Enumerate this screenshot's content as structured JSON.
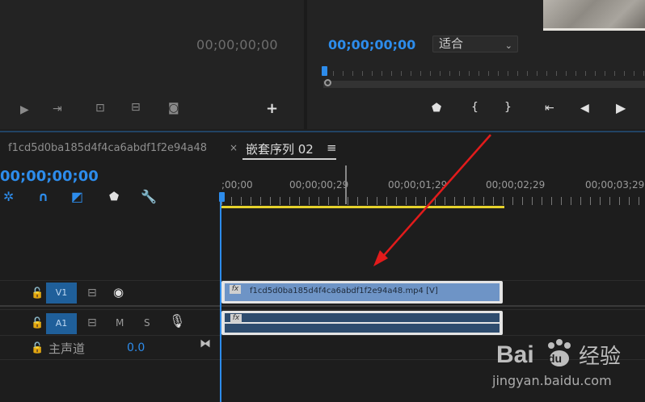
{
  "source_monitor": {
    "timecode": "00;00;00;00"
  },
  "program_monitor": {
    "timecode": "00;00;00;00",
    "fit_select": {
      "value": "适合"
    }
  },
  "timeline": {
    "tabs": [
      {
        "label": "f1cd5d0ba185d4f4ca6abdf1f2e94a48"
      },
      {
        "label": "嵌套序列 02",
        "close": "×",
        "menu": "≡"
      }
    ],
    "timecode": "00;00;00;00",
    "ruler_labels": [
      ";00;00",
      "00;00;00;29",
      "00;00;01;29",
      "00;00;02;29",
      "00;00;03;29"
    ],
    "tracks": {
      "v1": {
        "label": "V1"
      },
      "a1": {
        "label": "A1",
        "mute": "M",
        "solo": "S"
      }
    },
    "master": {
      "label": "主声道",
      "volume": "0.0"
    },
    "clips": {
      "v1": {
        "label": "f1cd5d0ba185d4f4ca6abdf1f2e94a48.mp4 [V]",
        "fx": "fx"
      },
      "a1": {
        "fx": "fx"
      }
    }
  },
  "watermark": {
    "logo": "Baidu 经验",
    "url": "jingyan.baidu.com"
  },
  "colors": {
    "accent": "#2d8ceb",
    "workbar": "#e6d22c",
    "arrow": "#e21b1b"
  }
}
